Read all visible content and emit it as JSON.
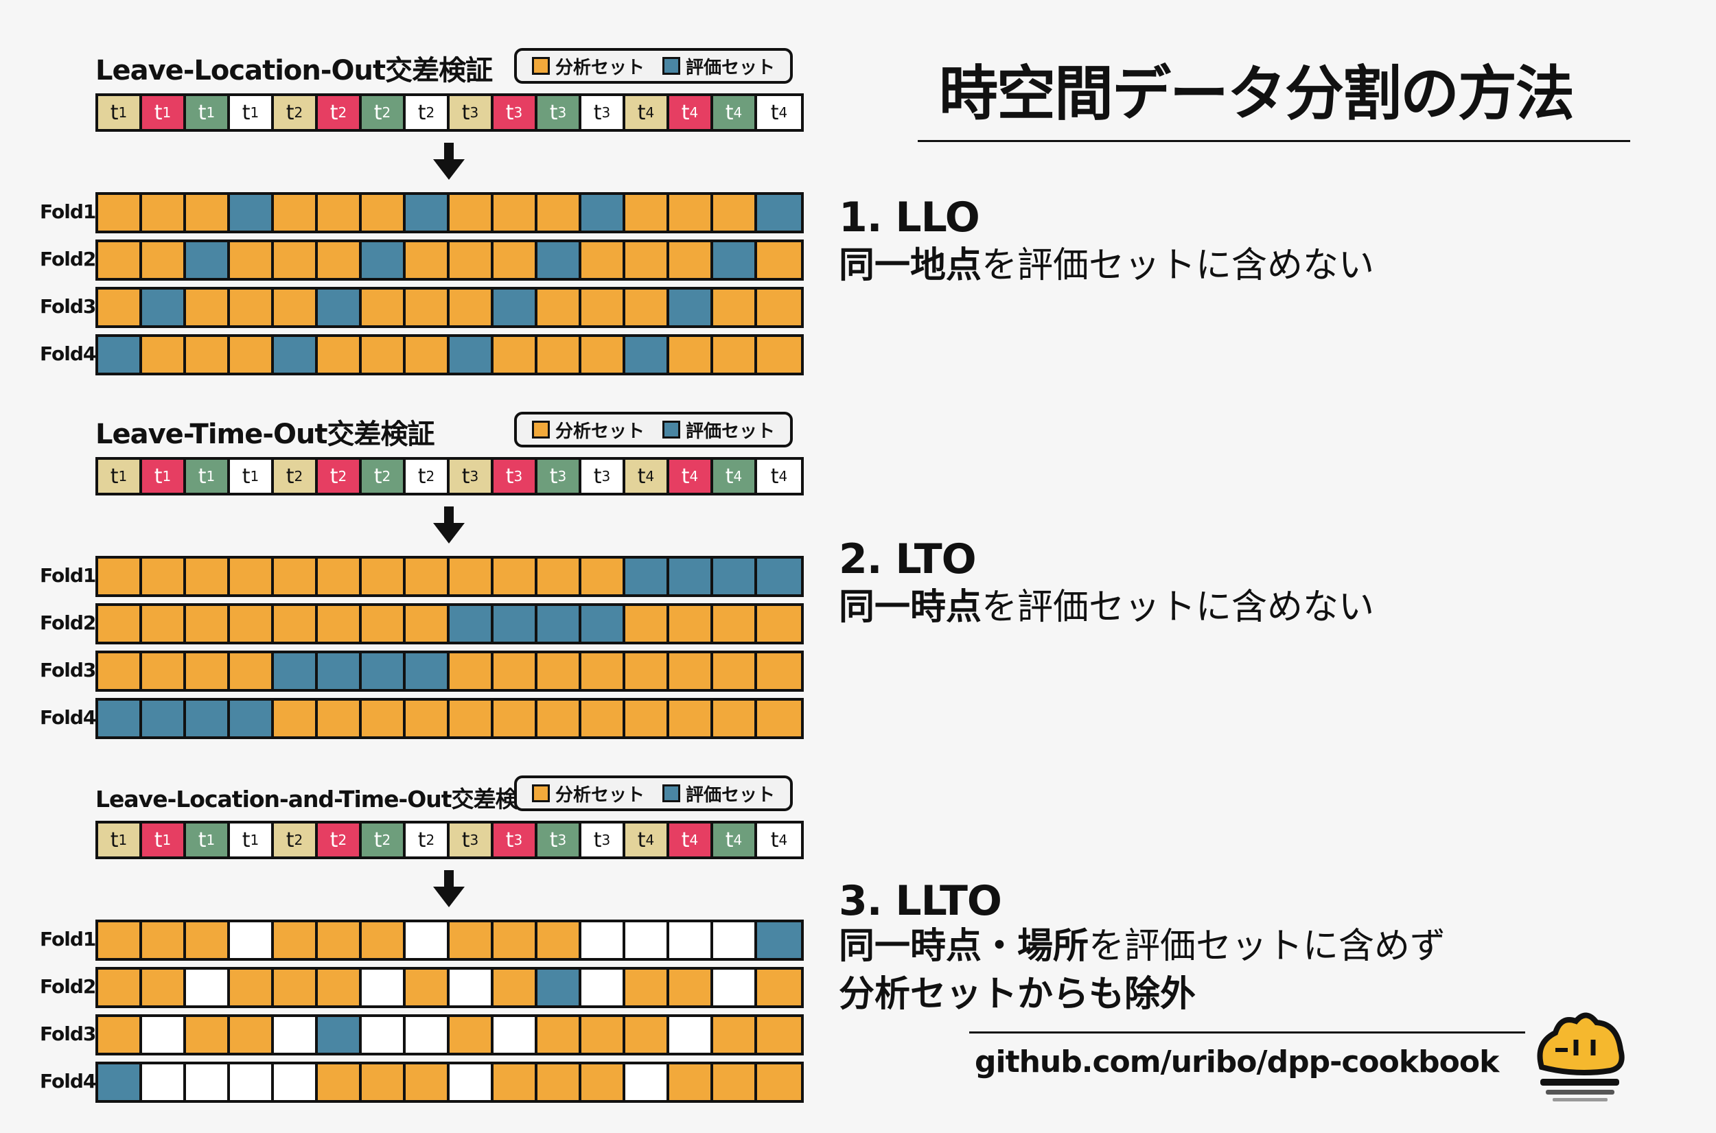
{
  "main_title": "時空間データ分割の方法",
  "colors": {
    "analysis": "#f2a93b",
    "evaluation": "#4a86a3",
    "excluded": "#ffffff",
    "t_tan": "#e3d39a",
    "t_pink": "#e63e62",
    "t_green": "#6e9e7c",
    "t_white": "#ffffff"
  },
  "legend": {
    "analysis": "分析セット",
    "evaluation": "評価セット"
  },
  "time_row": {
    "base": [
      "t",
      "t",
      "t",
      "t",
      "t",
      "t",
      "t",
      "t",
      "t",
      "t",
      "t",
      "t",
      "t",
      "t",
      "t",
      "t"
    ],
    "sub": [
      "1",
      "1",
      "1",
      "1",
      "2",
      "2",
      "2",
      "2",
      "3",
      "3",
      "3",
      "3",
      "4",
      "4",
      "4",
      "4"
    ],
    "colors": [
      "tan",
      "pink",
      "green",
      "white",
      "tan",
      "pink",
      "green",
      "white",
      "tan",
      "pink",
      "green",
      "white",
      "tan",
      "pink",
      "green",
      "white"
    ]
  },
  "fold_labels": [
    "Fold1",
    "Fold2",
    "Fold3",
    "Fold4"
  ],
  "sections": [
    {
      "title": "Leave-Location-Out交差検証",
      "right_title": "1. LLO",
      "right_desc_bold": "同一地点",
      "right_desc_rest": "を評価セットに含めない",
      "folds": [
        "AAAEAAAEAAAEAAAE",
        "AAEAAAEAAAEAAAEA",
        "AEAAAEAAAEAAAEAA",
        "EAAAEAAAEAAAEAAA"
      ]
    },
    {
      "title": "Leave-Time-Out交差検証",
      "right_title": "2. LTO",
      "right_desc_bold": "同一時点",
      "right_desc_rest": "を評価セットに含めない",
      "folds": [
        "AAAAAAAAAAAAEEEE",
        "AAAAAAAAEEEEAAAA",
        "AAAAEEEEAAAAAAAA",
        "EEEEAAAAAAAAAAAA"
      ]
    },
    {
      "title": "Leave-Location-and-Time-Out交差検証",
      "right_title": "3. LLTO",
      "right_desc_bold": "同一時点・場所",
      "right_desc_rest": "を評価セットに含めず",
      "right_desc_line2": "分析セットからも除外",
      "folds": [
        "AAAXAAAXAAAXXXXE",
        "AAXAAAXAXAEXAAXA",
        "AXAAXEXXAXAAAXAA",
        "EXXXXAAAXAAAXAAA"
      ]
    }
  ],
  "footer": "github.com/uribo/dpp-cookbook"
}
